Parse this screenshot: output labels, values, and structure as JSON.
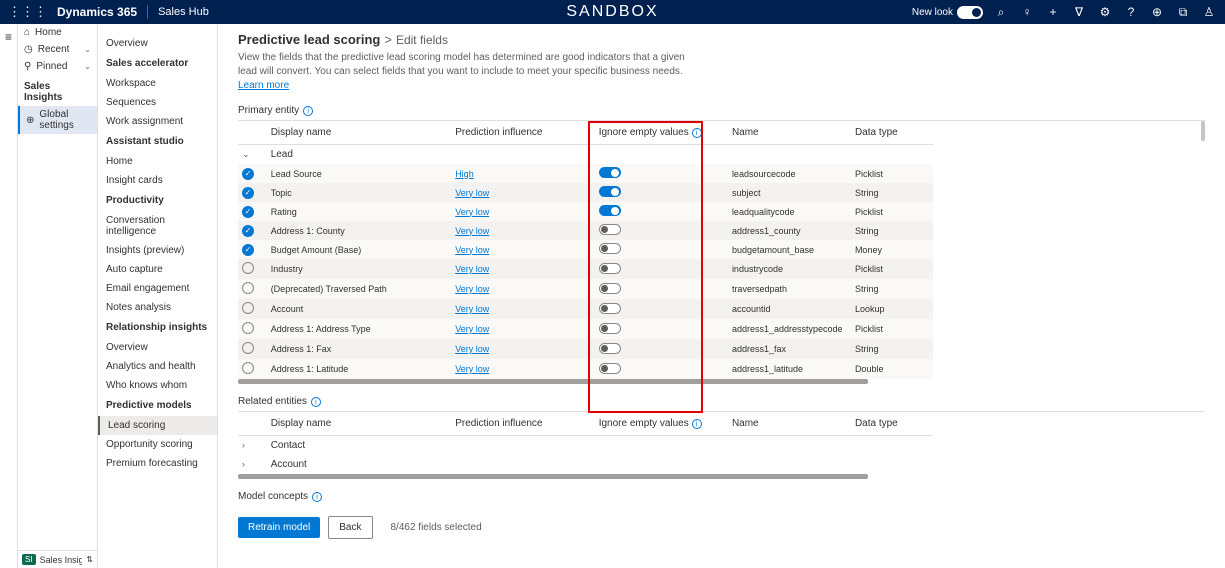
{
  "top": {
    "brand": "Dynamics 365",
    "app": "Sales Hub",
    "env": "SANDBOX",
    "newlook": "New look"
  },
  "leftnav": {
    "home": "Home",
    "recent": "Recent",
    "pinned": "Pinned",
    "salesinsights": "Sales Insights",
    "globalsettings": "Global settings",
    "footer": "Sales Insights sett..."
  },
  "subnav": {
    "groups": [
      {
        "items": [
          "Overview"
        ]
      },
      {
        "title": "Sales accelerator",
        "items": [
          "Workspace",
          "Sequences",
          "Work assignment"
        ]
      },
      {
        "title": "Assistant studio",
        "items": [
          "Home",
          "Insight cards"
        ]
      },
      {
        "title": "Productivity",
        "items": [
          "Conversation intelligence",
          "Insights (preview)",
          "Auto capture",
          "Email engagement",
          "Notes analysis"
        ]
      },
      {
        "title": "Relationship insights",
        "items": [
          "Overview",
          "Analytics and health",
          "Who knows whom"
        ]
      },
      {
        "title": "Predictive models",
        "items": [
          "Lead scoring",
          "Opportunity scoring",
          "Premium forecasting"
        ]
      }
    ],
    "active": "Lead scoring"
  },
  "main": {
    "crumb_main": "Predictive lead scoring",
    "crumb_sub": "Edit fields",
    "desc": "View the fields that the predictive lead scoring model has determined are good indicators that a given lead will convert. You can select fields that you want to include to meet your specific business needs. ",
    "learn": "Learn more",
    "primary_entity": "Primary entity",
    "related_entities": "Related entities",
    "model_concepts": "Model concepts",
    "cols": {
      "name": "Display name",
      "infl": "Prediction influence",
      "ignore": "Ignore empty values",
      "dbname": "Name",
      "type": "Data type"
    },
    "entity_lead": "Lead",
    "entity_contact": "Contact",
    "entity_account": "Account",
    "rows": [
      {
        "checked": true,
        "name": "Lead Source",
        "infl": "High",
        "ignore": true,
        "dbname": "leadsourcecode",
        "type": "Picklist"
      },
      {
        "checked": true,
        "name": "Topic",
        "infl": "Very low",
        "ignore": true,
        "dbname": "subject",
        "type": "String"
      },
      {
        "checked": true,
        "name": "Rating",
        "infl": "Very low",
        "ignore": true,
        "dbname": "leadqualitycode",
        "type": "Picklist"
      },
      {
        "checked": true,
        "name": "Address 1: County",
        "infl": "Very low",
        "ignore": false,
        "dbname": "address1_county",
        "type": "String"
      },
      {
        "checked": true,
        "name": "Budget Amount (Base)",
        "infl": "Very low",
        "ignore": false,
        "dbname": "budgetamount_base",
        "type": "Money"
      },
      {
        "checked": false,
        "name": "Industry",
        "infl": "Very low",
        "ignore": false,
        "dbname": "industrycode",
        "type": "Picklist"
      },
      {
        "checked": false,
        "name": "(Deprecated) Traversed Path",
        "infl": "Very low",
        "ignore": false,
        "dbname": "traversedpath",
        "type": "String"
      },
      {
        "checked": false,
        "name": "Account",
        "infl": "Very low",
        "ignore": false,
        "dbname": "accountid",
        "type": "Lookup"
      },
      {
        "checked": false,
        "name": "Address 1: Address Type",
        "infl": "Very low",
        "ignore": false,
        "dbname": "address1_addresstypecode",
        "type": "Picklist"
      },
      {
        "checked": false,
        "name": "Address 1: Fax",
        "infl": "Very low",
        "ignore": false,
        "dbname": "address1_fax",
        "type": "String"
      },
      {
        "checked": false,
        "name": "Address 1: Latitude",
        "infl": "Very low",
        "ignore": false,
        "dbname": "address1_latitude",
        "type": "Double"
      }
    ],
    "retrain": "Retrain model",
    "back": "Back",
    "selected": "8/462 fields selected"
  }
}
